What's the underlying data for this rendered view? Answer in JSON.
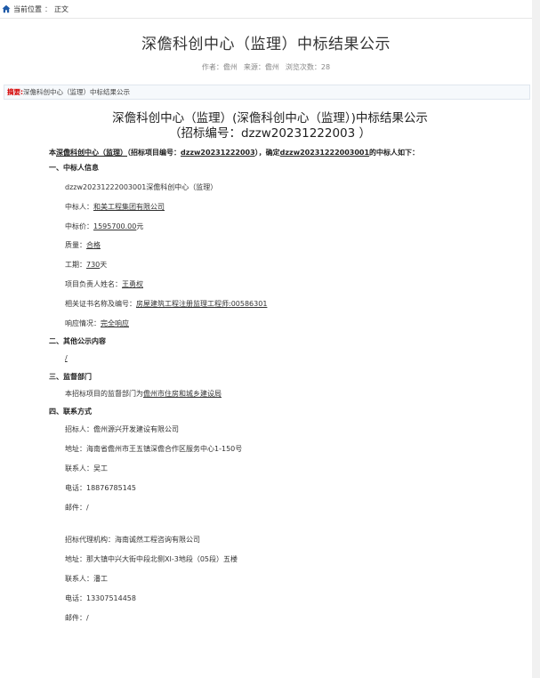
{
  "breadcrumb": {
    "label": "当前位置",
    "sep": "：",
    "current": "正文"
  },
  "title": "深儋科创中心（监理）中标结果公示",
  "meta": {
    "author": "作者：儋州",
    "source": "来源：儋州",
    "views": "浏览次数：28"
  },
  "summary": {
    "label": "摘要:",
    "text": " 深儋科创中心（监理）中标结果公示"
  },
  "doc_title": {
    "line1": "深儋科创中心（监理）(深儋科创中心（监理）)中标结果公示",
    "line2": "（招标编号：dzzw20231222003 ）"
  },
  "intro": {
    "p1": "本",
    "project": "深儋科创中心（监理）",
    "p2": "（招标项目编号：",
    "code": "dzzw20231222003",
    "p3": "），确定",
    "lot": "dzzw20231222003001",
    "p4": "的中标人如下："
  },
  "sections": {
    "s1": "一、中标人信息",
    "s2": "二、其他公示内容",
    "s3": "三、监督部门",
    "s4": "四、联系方式"
  },
  "winner": {
    "lot_name": "dzzw20231222003001深儋科创中心（监理）",
    "bidder_label": "中标人：",
    "bidder": "和美工程集团有限公司",
    "price_label": "中标价：",
    "price": "1595700.00",
    "price_unit": "元",
    "quality_label": "质量：",
    "quality": "合格",
    "period_label": "工期：",
    "period": "730",
    "period_unit": "天",
    "manager_label": "项目负责人姓名：",
    "manager": "王勇权",
    "cert_label": "相关证书名称及编号：",
    "cert": "房屋建筑工程注册监理工程师:00586301",
    "response_label": "响应情况：",
    "response": "完全响应"
  },
  "other": {
    "content": "/"
  },
  "supervision": {
    "p1": "本招标项目的监督部门为",
    "dept": "儋州市住房和城乡建设局"
  },
  "contact": {
    "tenderer": "招标人：儋州源兴开发建设有限公司",
    "address1": "地址：海南省儋州市王五镇深儋合作区服务中心1-150号",
    "person1": "联系人：吴工",
    "phone1": "电话：18876785145",
    "email1": "邮件：/",
    "agency": "招标代理机构：海南诚然工程咨询有限公司",
    "address2": "地址：那大镇中兴大街中段北侧XI-3地段（05段）五楼",
    "person2": "联系人：潘工",
    "phone2": "电话：13307514458",
    "email2": "邮件：/"
  },
  "colors": {
    "summary_label": "#d40000",
    "home_icon": "#1e5aa8"
  },
  "icons": {
    "breadcrumb_icon": "home-icon"
  }
}
